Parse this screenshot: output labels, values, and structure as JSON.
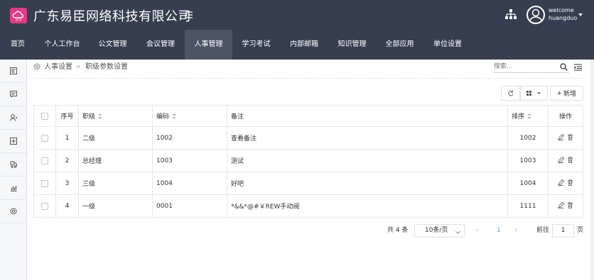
{
  "header": {
    "brand": "广东易臣网络科技有限公司",
    "logo_mark": "云OA",
    "welcome": "welcome",
    "username": "huangduo"
  },
  "nav": {
    "items": [
      "首页",
      "个人工作台",
      "公文管理",
      "会议管理",
      "人事管理",
      "学习考试",
      "内部邮箱",
      "知识管理",
      "全部应用",
      "单位设置"
    ],
    "active": "人事管理"
  },
  "sidebar": {
    "icons": [
      "form-icon",
      "message-icon",
      "user-icon",
      "plus-box-icon",
      "car-icon",
      "chart-icon",
      "settings-icon"
    ]
  },
  "breadcrumb": {
    "parent": "人事设置",
    "current": "职级参数设置"
  },
  "search": {
    "placeholder": "搜索..."
  },
  "toolbar": {
    "add_label": "新增"
  },
  "table": {
    "columns": {
      "index": "序号",
      "rank": "职级",
      "code": "编码",
      "note": "备注",
      "sort": "排序",
      "action": "操作"
    },
    "rows": [
      {
        "index": "1",
        "rank": "二级",
        "code": "1002",
        "note": "查看备注",
        "sort": "1002"
      },
      {
        "index": "2",
        "rank": "总经理",
        "code": "1003",
        "note": "测试",
        "sort": "1003"
      },
      {
        "index": "3",
        "rank": "三级",
        "code": "1004",
        "note": "好吧",
        "sort": "1004"
      },
      {
        "index": "4",
        "rank": "一级",
        "code": "0001",
        "note": "*&&*@#￥REW手动阀",
        "sort": "1111"
      }
    ]
  },
  "pagination": {
    "total": "共 4 条",
    "page_size": "10条/页",
    "current_page": "1",
    "goto_label": "前往",
    "goto_value": "1",
    "page_unit": "页"
  },
  "colors": {
    "header_bg": "#353f50",
    "nav_active": "#4b5566",
    "accent": "#409eff",
    "logo": "#e23a85"
  }
}
